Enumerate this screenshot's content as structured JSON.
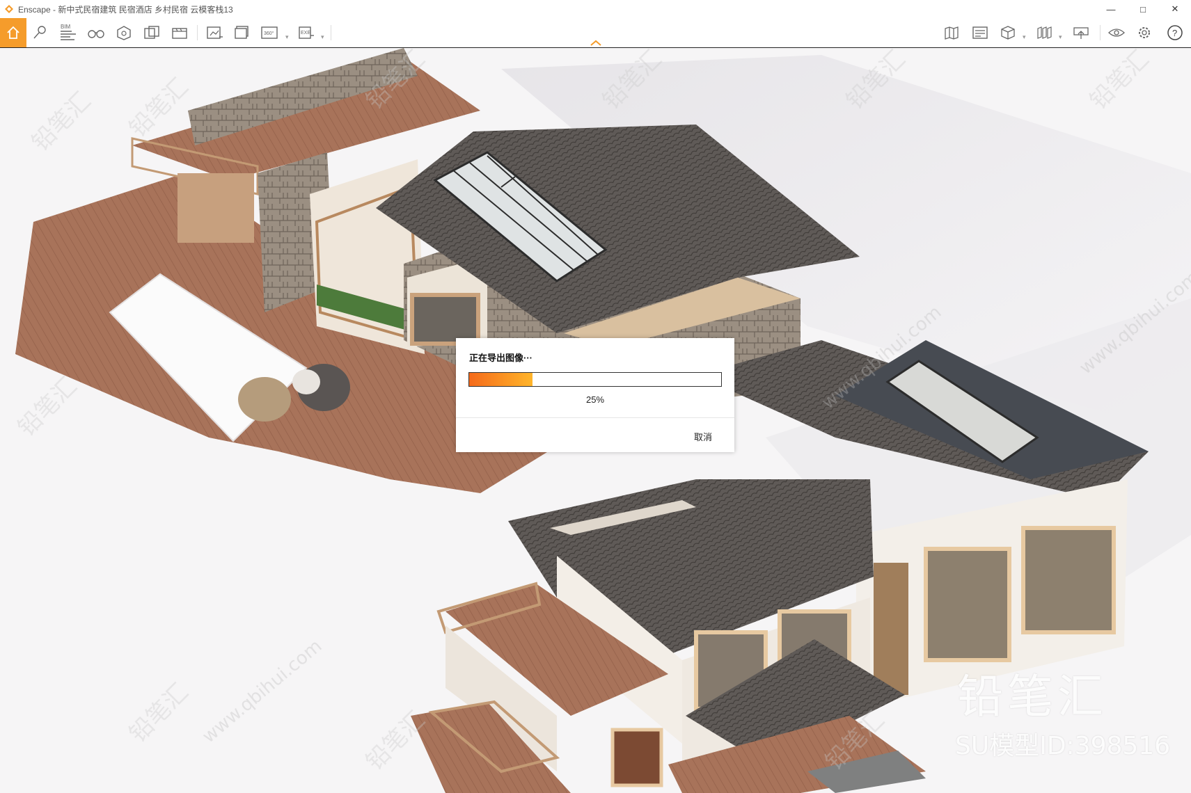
{
  "window": {
    "title": "Enscape - 新中式民宿建筑 民宿酒店 乡村民宿 云模客栈13",
    "controls": {
      "minimize": "—",
      "maximize": "□",
      "close": "✕"
    }
  },
  "toolbar": {
    "left_items": [
      "home-icon",
      "pin-icon",
      "bim-icon",
      "binoculars-icon",
      "asset-library-icon",
      "views-icon",
      "video-editor-icon",
      "screenshot-icon",
      "batch-render-icon",
      "panorama-360-icon",
      "export-exe-icon"
    ],
    "bim_label": "BIM",
    "panorama_label": "360°",
    "exe_label": "EXE",
    "right_items": [
      "map-icon",
      "info-icon",
      "cube-icon",
      "atlas-icon",
      "upload-icon",
      "eye-icon",
      "settings-icon",
      "help-icon"
    ],
    "help_label": "?",
    "accent_color": "#f59c2b"
  },
  "dialog": {
    "title": "正在导出图像···",
    "progress": 0.25,
    "progress_label": "25%",
    "cancel_label": "取消"
  },
  "watermarks": {
    "brand": "铅笔汇",
    "model_id": "SU模型ID:398516",
    "tile_text": "铅笔汇",
    "tile_url": "www.qbihui.com"
  }
}
